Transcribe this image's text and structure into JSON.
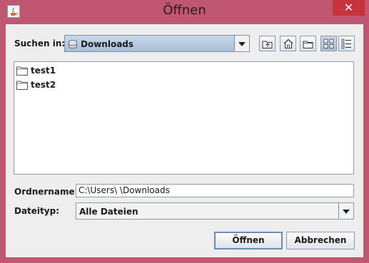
{
  "window": {
    "title": "Öffnen",
    "close_glyph": "✕"
  },
  "toolbar": {
    "look_in_label": "Suchen in:",
    "look_in_value": "Downloads",
    "buttons": [
      {
        "icon": "up-one-level-icon"
      },
      {
        "icon": "home-icon"
      },
      {
        "icon": "new-folder-icon"
      },
      {
        "icon": "list-view-icon"
      },
      {
        "icon": "details-view-icon"
      }
    ]
  },
  "files": [
    {
      "name": "test1",
      "icon": "folder-icon"
    },
    {
      "name": "test2",
      "icon": "folder-icon"
    }
  ],
  "folder_name": {
    "label": "Ordnername:",
    "value": "C:\\Users\\                \\Downloads"
  },
  "file_type": {
    "label": "Dateityp:",
    "value": "Alle Dateien"
  },
  "actions": {
    "open_label": "Öffnen",
    "cancel_label": "Abbrechen"
  },
  "colors": {
    "frame": "#c0566f",
    "close": "#c7333a",
    "panel": "#eeeeee"
  }
}
